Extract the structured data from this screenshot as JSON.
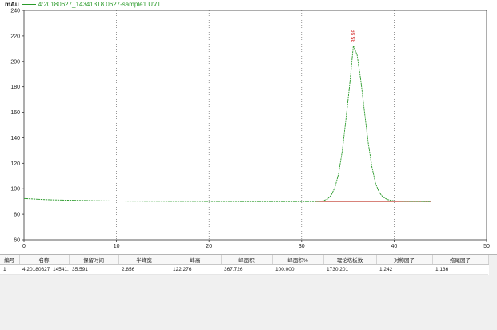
{
  "chart_data": {
    "type": "line",
    "ylabel": "mAu",
    "series": [
      {
        "name": "4:20180627_14341318 0627-sample1 UV1",
        "points": [
          [
            0,
            92.4
          ],
          [
            1,
            92.0
          ],
          [
            2,
            91.6
          ],
          [
            3,
            91.3
          ],
          [
            5,
            91.0
          ],
          [
            8,
            90.6
          ],
          [
            10,
            90.4
          ],
          [
            12,
            90.3
          ],
          [
            15,
            90.2
          ],
          [
            20,
            90.1
          ],
          [
            25,
            90.0
          ],
          [
            30,
            90.0
          ],
          [
            31.5,
            90.0
          ],
          [
            32.3,
            90.5
          ],
          [
            32.8,
            92
          ],
          [
            33.2,
            95
          ],
          [
            33.6,
            101
          ],
          [
            34.0,
            112
          ],
          [
            34.4,
            130
          ],
          [
            34.8,
            155
          ],
          [
            35.2,
            182
          ],
          [
            35.591,
            212.3
          ],
          [
            36.0,
            205
          ],
          [
            36.4,
            185
          ],
          [
            36.8,
            160
          ],
          [
            37.2,
            136
          ],
          [
            37.6,
            117
          ],
          [
            38.0,
            104
          ],
          [
            38.4,
            97
          ],
          [
            38.8,
            93.5
          ],
          [
            39.3,
            91.5
          ],
          [
            40,
            90.5
          ],
          [
            41,
            90.2
          ],
          [
            42,
            90.1
          ],
          [
            44,
            90.0
          ]
        ]
      }
    ],
    "baseline": {
      "x": [
        31.5,
        44
      ],
      "y": [
        90.0,
        90.0
      ],
      "color": "#c0392b"
    },
    "peak_label": {
      "x": 35.591,
      "y": 212.3,
      "text": "35.59"
    },
    "xlim": [
      0,
      50
    ],
    "ylim": [
      60,
      240
    ],
    "xticks": [
      0,
      10,
      20,
      30,
      40,
      50
    ],
    "yticks": [
      60,
      80,
      100,
      120,
      140,
      160,
      180,
      200,
      220,
      240
    ],
    "grid": "dotted",
    "legend_position": "top-left"
  },
  "legend": {
    "unit": "mAu",
    "series_name": "4:20180627_14341318 0627-sample1 UV1"
  },
  "colors": {
    "trace": "#2a9a2a",
    "baseline": "#c0392b",
    "peak_label": "#d11a1a",
    "axis": "#333333"
  },
  "table": {
    "headers": [
      "編号",
      "名称",
      "保留时间",
      "半峰宽",
      "峰高",
      "峰面积",
      "峰面积%",
      "理论塔板数",
      "对称因子",
      "拖尾因子"
    ],
    "rows": [
      [
        "1",
        "4:20180627_14541...",
        "35.591",
        "2.856",
        "122.276",
        "367.726",
        "100.000",
        "1730.201",
        "1.242",
        "1.136"
      ]
    ]
  }
}
